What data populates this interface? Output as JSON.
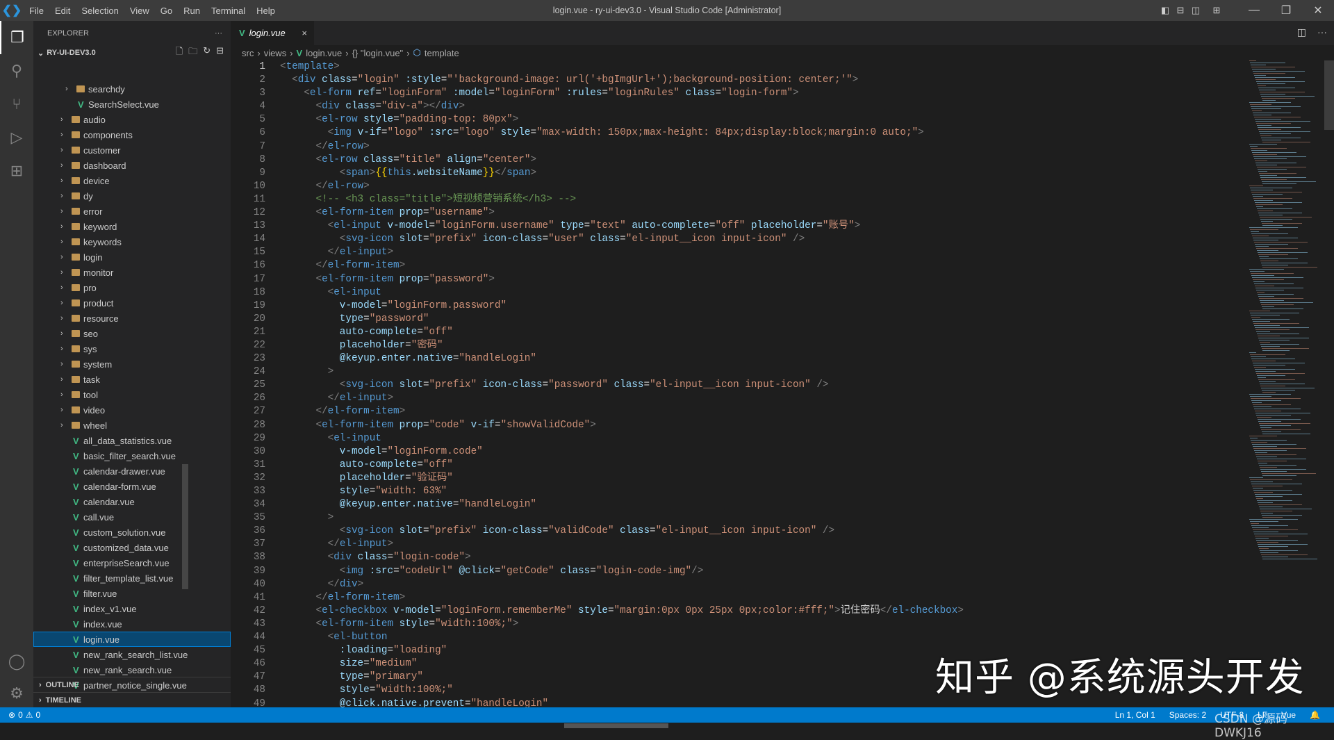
{
  "titlebar": {
    "menus": [
      "File",
      "Edit",
      "Selection",
      "View",
      "Go",
      "Run",
      "Terminal",
      "Help"
    ],
    "title": "login.vue - ry-ui-dev3.0 - Visual Studio Code [Administrator]"
  },
  "sidebar": {
    "header": "EXPLORER",
    "project": "RY-UI-DEV3.0",
    "items": [
      {
        "type": "folder",
        "label": "searchdy",
        "depth": 2
      },
      {
        "type": "file",
        "label": "SearchSelect.vue",
        "depth": 2
      },
      {
        "type": "folder",
        "label": "audio",
        "depth": 1
      },
      {
        "type": "folder",
        "label": "components",
        "depth": 1
      },
      {
        "type": "folder",
        "label": "customer",
        "depth": 1
      },
      {
        "type": "folder",
        "label": "dashboard",
        "depth": 1
      },
      {
        "type": "folder",
        "label": "device",
        "depth": 1
      },
      {
        "type": "folder",
        "label": "dy",
        "depth": 1
      },
      {
        "type": "folder",
        "label": "error",
        "depth": 1
      },
      {
        "type": "folder",
        "label": "keyword",
        "depth": 1
      },
      {
        "type": "folder",
        "label": "keywords",
        "depth": 1
      },
      {
        "type": "folder",
        "label": "login",
        "depth": 1
      },
      {
        "type": "folder",
        "label": "monitor",
        "depth": 1
      },
      {
        "type": "folder",
        "label": "pro",
        "depth": 1
      },
      {
        "type": "folder",
        "label": "product",
        "depth": 1
      },
      {
        "type": "folder",
        "label": "resource",
        "depth": 1
      },
      {
        "type": "folder",
        "label": "seo",
        "depth": 1
      },
      {
        "type": "folder",
        "label": "sys",
        "depth": 1
      },
      {
        "type": "folder",
        "label": "system",
        "depth": 1
      },
      {
        "type": "folder",
        "label": "task",
        "depth": 1
      },
      {
        "type": "folder",
        "label": "tool",
        "depth": 1
      },
      {
        "type": "folder",
        "label": "video",
        "depth": 1
      },
      {
        "type": "folder",
        "label": "wheel",
        "depth": 1
      },
      {
        "type": "file",
        "label": "all_data_statistics.vue",
        "depth": 1
      },
      {
        "type": "file",
        "label": "basic_filter_search.vue",
        "depth": 1
      },
      {
        "type": "file",
        "label": "calendar-drawer.vue",
        "depth": 1
      },
      {
        "type": "file",
        "label": "calendar-form.vue",
        "depth": 1
      },
      {
        "type": "file",
        "label": "calendar.vue",
        "depth": 1
      },
      {
        "type": "file",
        "label": "call.vue",
        "depth": 1
      },
      {
        "type": "file",
        "label": "custom_solution.vue",
        "depth": 1
      },
      {
        "type": "file",
        "label": "customized_data.vue",
        "depth": 1
      },
      {
        "type": "file",
        "label": "enterpriseSearch.vue",
        "depth": 1
      },
      {
        "type": "file",
        "label": "filter_template_list.vue",
        "depth": 1
      },
      {
        "type": "file",
        "label": "filter.vue",
        "depth": 1
      },
      {
        "type": "file",
        "label": "index_v1.vue",
        "depth": 1
      },
      {
        "type": "file",
        "label": "index.vue",
        "depth": 1
      },
      {
        "type": "file",
        "label": "login.vue",
        "depth": 1,
        "selected": true
      },
      {
        "type": "file",
        "label": "new_rank_search_list.vue",
        "depth": 1
      },
      {
        "type": "file",
        "label": "new_rank_search.vue",
        "depth": 1
      },
      {
        "type": "file",
        "label": "partner_notice_single.vue",
        "depth": 1
      }
    ],
    "outline": "OUTLINE",
    "timeline": "TIMELINE"
  },
  "tab": {
    "label": "login.vue",
    "close": "×"
  },
  "breadcrumb": [
    "src",
    "views",
    "login.vue",
    "{} \"login.vue\"",
    "template"
  ],
  "code": [
    "<template>",
    "  <div class=\"login\" :style=\"'background-image: url('+bgImgUrl+');background-position: center;'\">",
    "    <el-form ref=\"loginForm\" :model=\"loginForm\" :rules=\"loginRules\" class=\"login-form\">",
    "      <div class=\"div-a\"></div>",
    "      <el-row style=\"padding-top: 80px\">",
    "        <img v-if=\"logo\" :src=\"logo\" style=\"max-width: 150px;max-height: 84px;display:block;margin:0 auto;\">",
    "      </el-row>",
    "      <el-row class=\"title\" align=\"center\">",
    "          <span>{{this.websiteName}}</span>",
    "      </el-row>",
    "      <!-- <h3 class=\"title\">短视频营销系统</h3> -->",
    "      <el-form-item prop=\"username\">",
    "        <el-input v-model=\"loginForm.username\" type=\"text\" auto-complete=\"off\" placeholder=\"账号\">",
    "          <svg-icon slot=\"prefix\" icon-class=\"user\" class=\"el-input__icon input-icon\" />",
    "        </el-input>",
    "      </el-form-item>",
    "      <el-form-item prop=\"password\">",
    "        <el-input",
    "          v-model=\"loginForm.password\"",
    "          type=\"password\"",
    "          auto-complete=\"off\"",
    "          placeholder=\"密码\"",
    "          @keyup.enter.native=\"handleLogin\"",
    "        >",
    "          <svg-icon slot=\"prefix\" icon-class=\"password\" class=\"el-input__icon input-icon\" />",
    "        </el-input>",
    "      </el-form-item>",
    "      <el-form-item prop=\"code\" v-if=\"showValidCode\">",
    "        <el-input",
    "          v-model=\"loginForm.code\"",
    "          auto-complete=\"off\"",
    "          placeholder=\"验证码\"",
    "          style=\"width: 63%\"",
    "          @keyup.enter.native=\"handleLogin\"",
    "        >",
    "          <svg-icon slot=\"prefix\" icon-class=\"validCode\" class=\"el-input__icon input-icon\" />",
    "        </el-input>",
    "        <div class=\"login-code\">",
    "          <img :src=\"codeUrl\" @click=\"getCode\" class=\"login-code-img\"/>",
    "        </div>",
    "      </el-form-item>",
    "      <el-checkbox v-model=\"loginForm.rememberMe\" style=\"margin:0px 0px 25px 0px;color:#fff;\">记住密码</el-checkbox>",
    "      <el-form-item style=\"width:100%;\">",
    "        <el-button",
    "          :loading=\"loading\"",
    "          size=\"medium\"",
    "          type=\"primary\"",
    "          style=\"width:100%;\"",
    "          @click.native.prevent=\"handleLogin\""
  ],
  "statusbar": {
    "errors": "0",
    "warnings": "0",
    "position": "Ln 1, Col 1",
    "spaces": "Spaces: 2",
    "encoding": "UTF-8",
    "eol": "LF",
    "language": "Vue"
  },
  "watermarks": {
    "zhihu": "知乎 @系统源头开发",
    "csdn": "CSDN @源码DWKJ16"
  }
}
